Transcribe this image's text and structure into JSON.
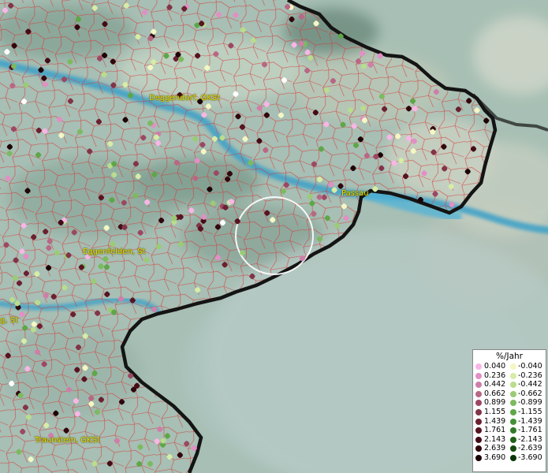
{
  "map": {
    "cities": [
      {
        "name": "Deggendorf, GKSt"
      },
      {
        "name": "Passau"
      },
      {
        "name": "Eggenfelden, St"
      },
      {
        "name": "g, St"
      },
      {
        "name": "Traunstein, GKSt"
      }
    ]
  },
  "legend": {
    "title": "%/Jahr",
    "positive": [
      "0.040",
      "0.236",
      "0.442",
      "0.662",
      "0.899",
      "1.155",
      "1.439",
      "1.761",
      "2.143",
      "2.639",
      "3.690"
    ],
    "negative": [
      "-0.040",
      "-0.236",
      "-0.442",
      "-0.662",
      "-0.899",
      "-1.155",
      "-1.439",
      "-1.761",
      "-2.143",
      "-2.639",
      "-3.690"
    ],
    "positive_colors": [
      "#f7b6e6",
      "#e28fc5",
      "#cf7ea9",
      "#b86784",
      "#9c4863",
      "#823448",
      "#6c2030",
      "#571421",
      "#440c16",
      "#31060d",
      "#1d0206"
    ],
    "negative_colors": [
      "#f4f7c4",
      "#d7eca6",
      "#b9dd8c",
      "#9bcb75",
      "#7cba5f",
      "#5ea748",
      "#439136",
      "#2f7a26",
      "#1e6318",
      "#124c0e",
      "#083506"
    ]
  }
}
